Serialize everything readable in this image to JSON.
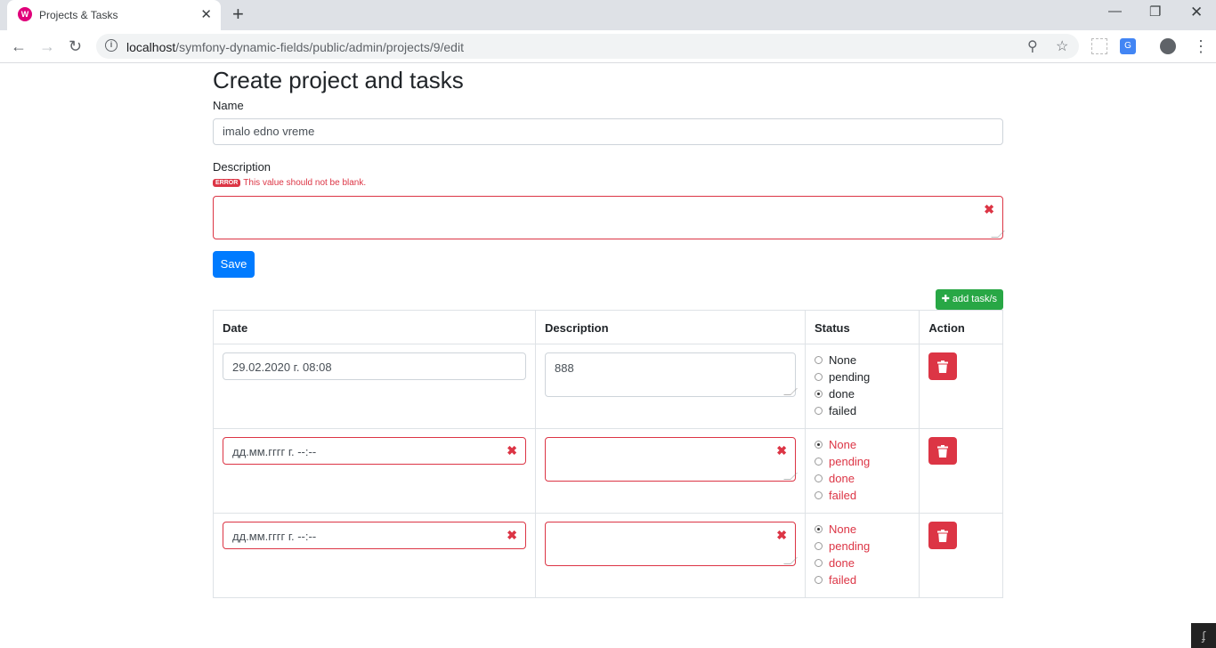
{
  "browser": {
    "tab_title": "Projects & Tasks",
    "url_host": "localhost",
    "url_path": "/symfony-dynamic-fields/public/admin/projects/9/edit"
  },
  "page": {
    "title": "Create project and tasks",
    "name_label": "Name",
    "name_value": "imalo edno vreme",
    "description_label": "Description",
    "error_badge": "ERROR",
    "error_message": "This value should not be blank.",
    "description_value": "",
    "save_label": "Save",
    "add_tasks_label": "add task/s"
  },
  "table": {
    "headers": [
      "Date",
      "Description",
      "Status",
      "Action"
    ],
    "status_options": [
      "None",
      "pending",
      "done",
      "failed"
    ],
    "rows": [
      {
        "date": "29.02.2020 г. 08:08",
        "description": "888",
        "status": "done",
        "invalid": false
      },
      {
        "date": "дд.мм.гггг г. --:--",
        "description": "",
        "status": "None",
        "invalid": true
      },
      {
        "date": "дд.мм.гггг г. --:--",
        "description": "",
        "status": "None",
        "invalid": true
      }
    ]
  },
  "colors": {
    "primary": "#007bff",
    "success": "#28a745",
    "danger": "#dc3545"
  }
}
